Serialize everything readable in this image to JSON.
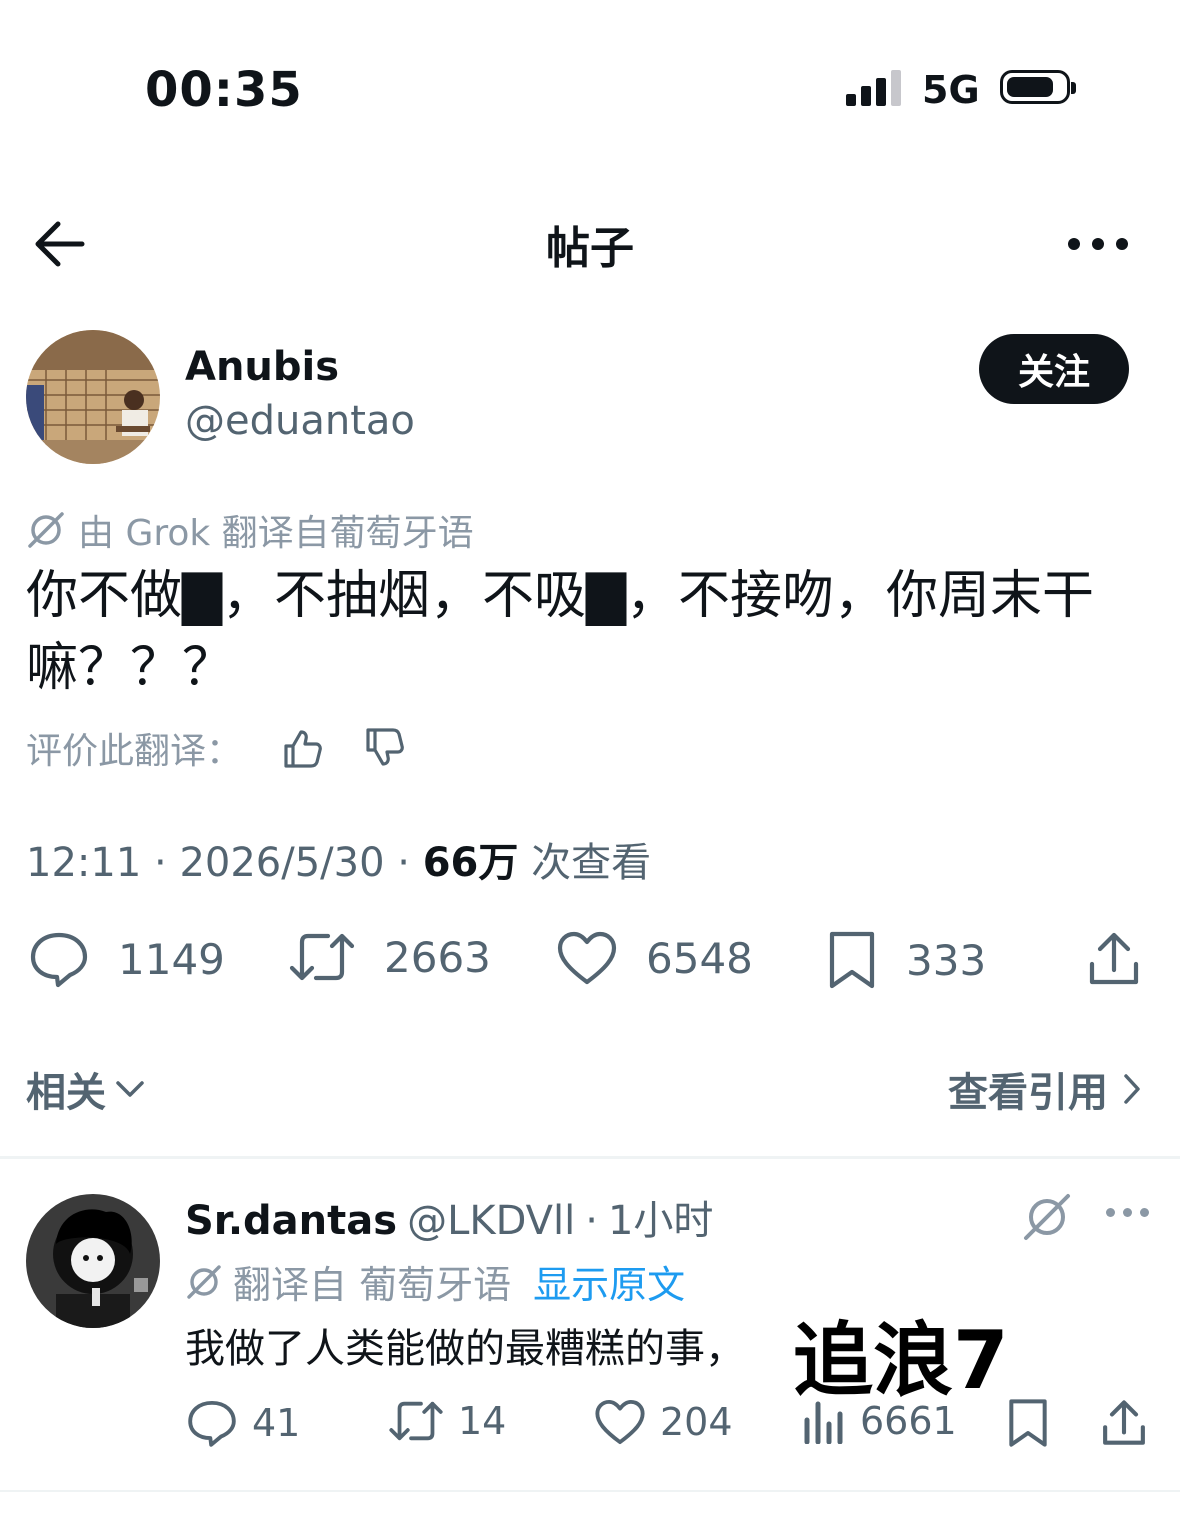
{
  "status_bar": {
    "time": "00:35",
    "network": "5G",
    "battery_level": 0.75
  },
  "header": {
    "title": "帖子",
    "back_icon": "arrow-left-icon",
    "more_icon": "more-horizontal-icon"
  },
  "post": {
    "author_name": "Anubis",
    "author_handle": "@eduantao",
    "follow_label": "关注",
    "translation_note": "由 Grok 翻译自葡萄牙语",
    "text": "你不做▇，不抽烟，不吸▇，不接吻，你周末干嘛？？？",
    "rate_label": "评价此翻译：",
    "time": "12:11",
    "date": "2026/5/30",
    "views_count": "66万",
    "views_label": "次查看",
    "stats": {
      "replies": "1149",
      "reposts": "2663",
      "likes": "6548",
      "bookmarks": "333"
    }
  },
  "related": {
    "label": "相关",
    "quotes_label": "查看引用"
  },
  "reply": {
    "author_name": "Sr.dantas",
    "author_handle": "@LKDVll",
    "time": "1小时",
    "translation_note": "翻译自 葡萄牙语",
    "show_original": "显示原文",
    "text": "我做了人类能做的最糟糕的事，",
    "stats": {
      "replies": "41",
      "reposts": "14",
      "likes": "204",
      "views": "6661"
    }
  },
  "overlay_text": "追浪7",
  "colors": {
    "text": "#0f1419",
    "secondary": "#536471",
    "muted": "#8b98a5",
    "link": "#1d9bf0",
    "button_bg": "#0f1419"
  }
}
